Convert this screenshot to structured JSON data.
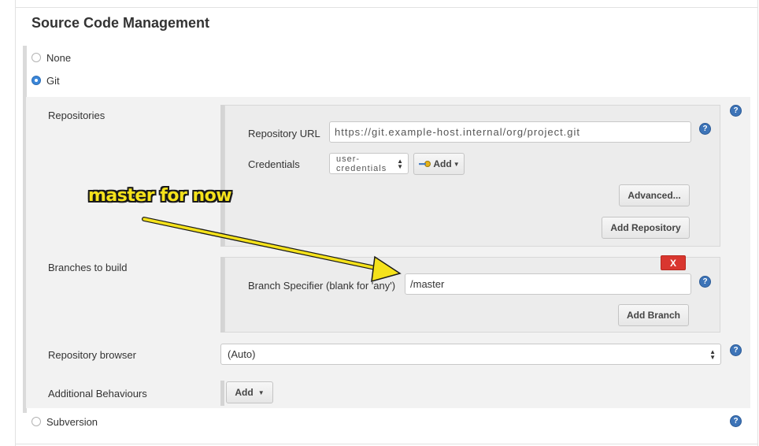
{
  "section": {
    "title": "Source Code Management"
  },
  "scm_options": {
    "none": "None",
    "git": "Git",
    "subversion": "Subversion"
  },
  "git": {
    "repositories_label": "Repositories",
    "repo_url_label": "Repository URL",
    "repo_url_value": "https://git.example-host.internal/org/project.git",
    "credentials_label": "Credentials",
    "credentials_value": "user-credentials",
    "add_credentials_label": "Add",
    "advanced_button": "Advanced...",
    "add_repository_button": "Add Repository",
    "branches_label": "Branches to build",
    "delete_branch_button": "X",
    "branch_specifier_label": "Branch Specifier (blank for 'any')",
    "branch_specifier_value": "/master",
    "add_branch_button": "Add Branch",
    "repo_browser_label": "Repository browser",
    "repo_browser_value": "(Auto)",
    "additional_behaviours_label": "Additional Behaviours",
    "add_behaviour_button": "Add"
  },
  "annotation": {
    "text": "master for now",
    "color": "#f5e21b"
  },
  "help_icon": "?"
}
